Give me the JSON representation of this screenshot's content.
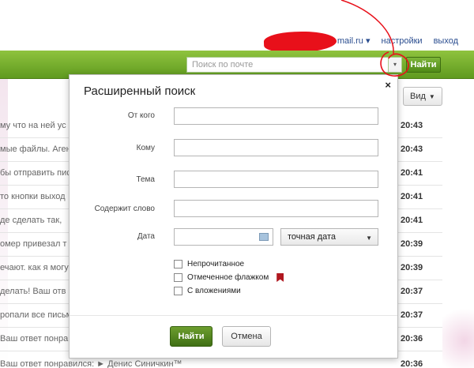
{
  "topbar": {
    "email_domain": "mail.ru",
    "email_arrow": "▾",
    "settings": "настройки",
    "logout": "выход"
  },
  "search": {
    "placeholder": "Поиск по почте",
    "dropdown_arrow": "▾",
    "find_label": "Найти"
  },
  "toolbar": {
    "view_label": "Вид",
    "view_arrow": "▼"
  },
  "messages": [
    {
      "subject": "му что на ней ус",
      "time": "20:43"
    },
    {
      "subject": "мые файлы. Аген",
      "time": "20:43"
    },
    {
      "subject": "бы отправить пис",
      "time": "20:41"
    },
    {
      "subject": "то кнопки выход",
      "time": "20:41"
    },
    {
      "subject": "де сделать так,",
      "time": "20:41"
    },
    {
      "subject": "омер привезал т",
      "time": "20:39"
    },
    {
      "subject": "ечают. как я могу",
      "time": "20:39"
    },
    {
      "subject": "делать! Ваш отв",
      "time": "20:37"
    },
    {
      "subject": "ропали все письм",
      "time": "20:37"
    },
    {
      "subject": "Ваш ответ понра",
      "time": "20:36"
    },
    {
      "subject": "Ваш ответ понравился: ► Денис Синичкин™",
      "time": "20:36"
    }
  ],
  "modal": {
    "title": "Расширенный поиск",
    "close": "×",
    "fields": {
      "from_label": "От кого",
      "to_label": "Кому",
      "topic_label": "Тема",
      "contains_label": "Содержит слово",
      "date_label": "Дата"
    },
    "date_mode": "точная дата",
    "date_mode_arrow": "▼",
    "checkboxes": {
      "unread": "Непрочитанное",
      "flagged": "Отмеченное флажком",
      "attachments": "С вложениями"
    },
    "find_button": "Найти",
    "cancel_button": "Отмена"
  },
  "colors": {
    "green_bar": "#6aa825",
    "annotation": "#e8101a",
    "flag": "#b0171f"
  },
  "icons": [
    "calendar-icon",
    "flag-icon",
    "close-icon",
    "chevron-down-icon"
  ]
}
